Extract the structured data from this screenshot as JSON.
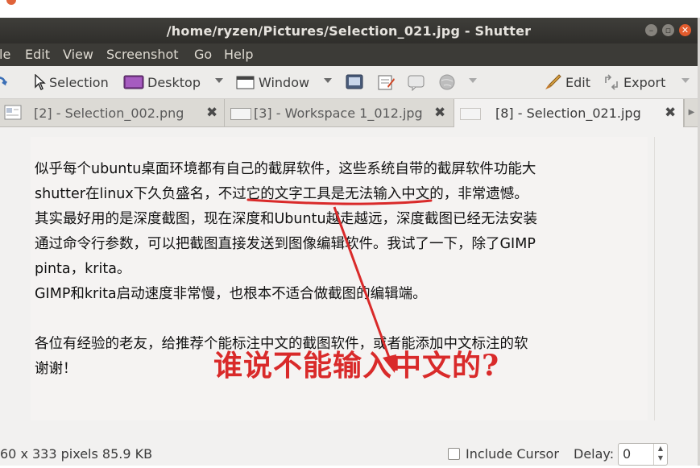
{
  "window": {
    "title": "/home/ryzen/Pictures/Selection_021.jpg - Shutter"
  },
  "menubar": {
    "items": [
      "le",
      "Edit",
      "View",
      "Screenshot",
      "Go",
      "Help"
    ]
  },
  "toolbar": {
    "selection_label": "Selection",
    "desktop_label": "Desktop",
    "window_label": "Window",
    "edit_label": "Edit",
    "export_label": "Export"
  },
  "tabs": [
    {
      "label": "[2] - Selection_002.png"
    },
    {
      "label": "[3] - Workspace 1_012.jpg"
    },
    {
      "label": "[8] - Selection_021.jpg"
    }
  ],
  "image_content": {
    "lines": [
      "似乎每个ubuntu桌面环境都有自己的截屏软件，这些系统自带的截屏软件功能大",
      "shutter在linux下久负盛名，不过它的文字工具是无法输入中文的，非常遗憾。",
      "其实最好用的是深度截图，现在深度和Ubuntu越走越远，深度截图已经无法安装",
      "通过命令行参数，可以把截图直接发送到图像编辑软件。我试了一下，除了GIMP",
      "pinta，krita。",
      "GIMP和krita启动速度非常慢，也根本不适合做截图的编辑端。",
      "",
      "各位有经验的老友，给推荐个能标注中文的截图软件，或者能添加中文标注的软",
      "谢谢！"
    ],
    "annotation": "谁说不能输入中文的?"
  },
  "statusbar": {
    "info": "60 x 333 pixels  85.9 KB",
    "include_cursor_label": "Include Cursor",
    "delay_label": "Delay:",
    "delay_value": "0"
  },
  "colors": {
    "annotation_red": "#d92a2a",
    "titlebar": "#3c3b37",
    "close_button": "#e25b2d"
  }
}
